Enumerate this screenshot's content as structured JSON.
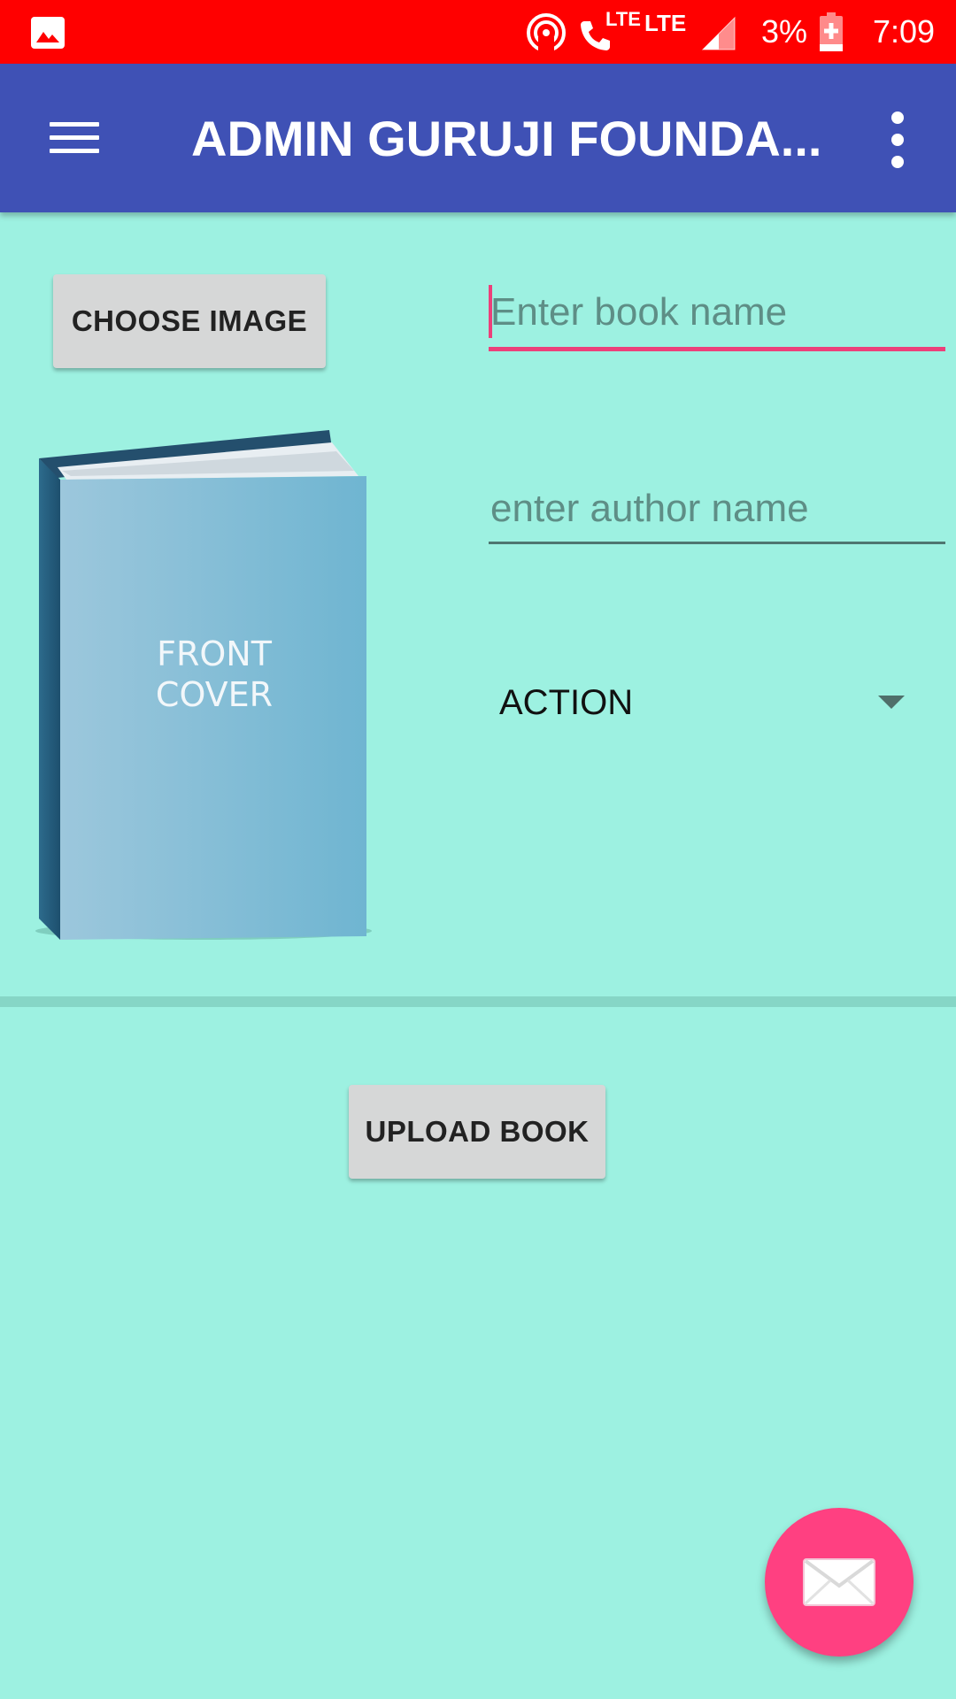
{
  "status_bar": {
    "lte_small": "LTE",
    "lte": "LTE",
    "battery": "3%",
    "time": "7:09"
  },
  "app_bar": {
    "title": "ADMIN GURUJI FOUNDA..."
  },
  "form": {
    "choose_image_label": "CHOOSE IMAGE",
    "book_cover_text": [
      "FRONT",
      "COVER"
    ],
    "book_name_placeholder": "Enter book name",
    "author_name_placeholder": "enter author name",
    "category_selected": "ACTION",
    "upload_label": "UPLOAD BOOK"
  },
  "colors": {
    "status_bar": "#ff0000",
    "app_bar": "#3f51b5",
    "background": "#9df1e1",
    "accent": "#ec407a",
    "fab": "#ff4081"
  },
  "icons": {
    "notification": "image-icon",
    "hotspot": "hotspot-icon",
    "call": "phone-icon",
    "signal": "signal-icon",
    "battery": "battery-charging-icon",
    "menu": "hamburger-menu-icon",
    "overflow": "more-vert-icon",
    "fab": "mail-icon",
    "dropdown": "dropdown-arrow-icon"
  }
}
